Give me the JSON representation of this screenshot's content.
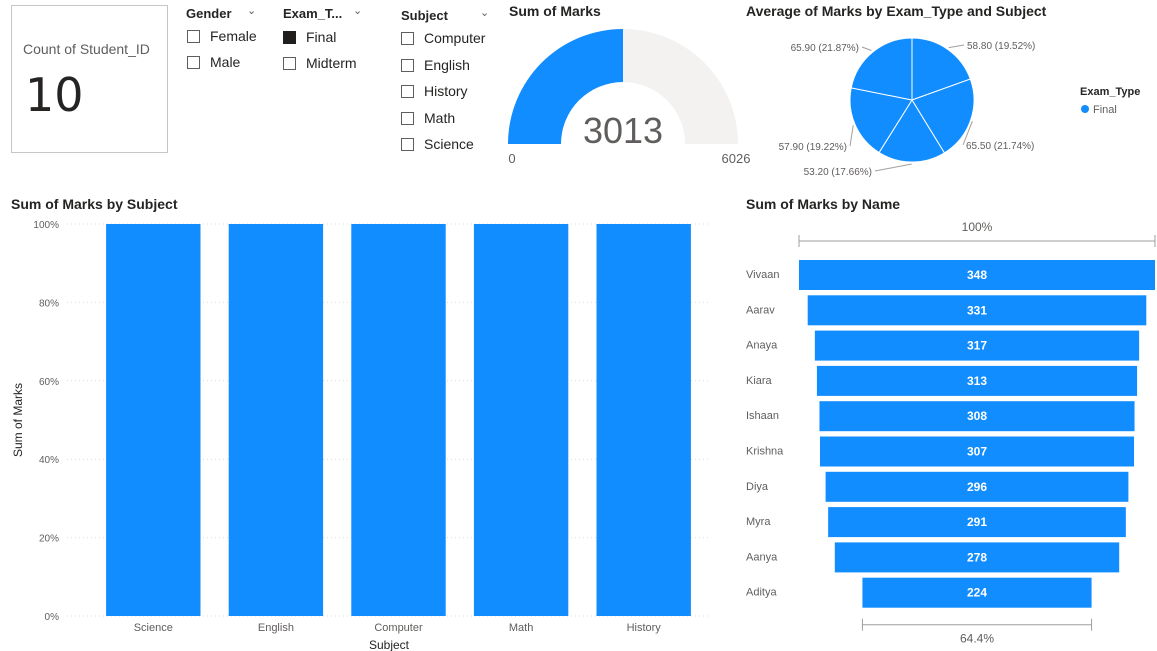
{
  "card": {
    "label": "Count of Student_ID",
    "value": "10"
  },
  "slicers": {
    "gender": {
      "title": "Gender",
      "options": [
        {
          "label": "Female",
          "checked": false
        },
        {
          "label": "Male",
          "checked": false
        }
      ]
    },
    "exam_type": {
      "title": "Exam_T...",
      "options": [
        {
          "label": "Final",
          "checked": true
        },
        {
          "label": "Midterm",
          "checked": false
        }
      ]
    },
    "subject": {
      "title": "Subject",
      "options": [
        {
          "label": "Computer",
          "checked": false
        },
        {
          "label": "English",
          "checked": false
        },
        {
          "label": "History",
          "checked": false
        },
        {
          "label": "Math",
          "checked": false
        },
        {
          "label": "Science",
          "checked": false
        }
      ]
    },
    "chevron_icon": "chevron-down-icon"
  },
  "colors": {
    "accent": "#118DFF",
    "gauge_track": "#F3F2F1",
    "grid": "#D9D9D9",
    "axis_text": "#605E5C"
  },
  "chart_data": [
    {
      "id": "gauge",
      "type": "gauge",
      "title": "Sum of Marks",
      "value": 3013,
      "min": 0,
      "max": 6026,
      "value_label": "3013",
      "min_label": "0",
      "max_label": "6026"
    },
    {
      "id": "pie",
      "type": "pie",
      "title": "Average of Marks by Exam_Type and Subject",
      "legend_title": "Exam_Type",
      "legend": [
        "Final"
      ],
      "legend_position": "right",
      "slices": [
        {
          "value": 58.8,
          "label": "58.80 (19.52%)"
        },
        {
          "value": 65.5,
          "label": "65.50 (21.74%)"
        },
        {
          "value": 53.2,
          "label": "53.20 (17.66%)"
        },
        {
          "value": 57.9,
          "label": "57.90 (19.22%)"
        },
        {
          "value": 65.9,
          "label": "65.90 (21.87%)"
        }
      ]
    },
    {
      "id": "bar",
      "type": "bar",
      "title": "Sum of Marks by Subject",
      "xlabel": "Subject",
      "ylabel": "Sum of Marks",
      "categories": [
        "Science",
        "English",
        "Computer",
        "Math",
        "History"
      ],
      "values": [
        100,
        100,
        100,
        100,
        100
      ],
      "ylim": [
        0,
        100
      ],
      "yticks": [
        "0%",
        "20%",
        "40%",
        "60%",
        "80%",
        "100%"
      ],
      "grid": true
    },
    {
      "id": "funnel",
      "type": "funnel",
      "title": "Sum of Marks by Name",
      "categories": [
        "Vivaan",
        "Aarav",
        "Anaya",
        "Kiara",
        "Ishaan",
        "Krishna",
        "Diya",
        "Myra",
        "Aanya",
        "Aditya"
      ],
      "values": [
        348,
        331,
        317,
        313,
        308,
        307,
        296,
        291,
        278,
        224
      ],
      "top_label": "100%",
      "bottom_label": "64.4%"
    }
  ]
}
